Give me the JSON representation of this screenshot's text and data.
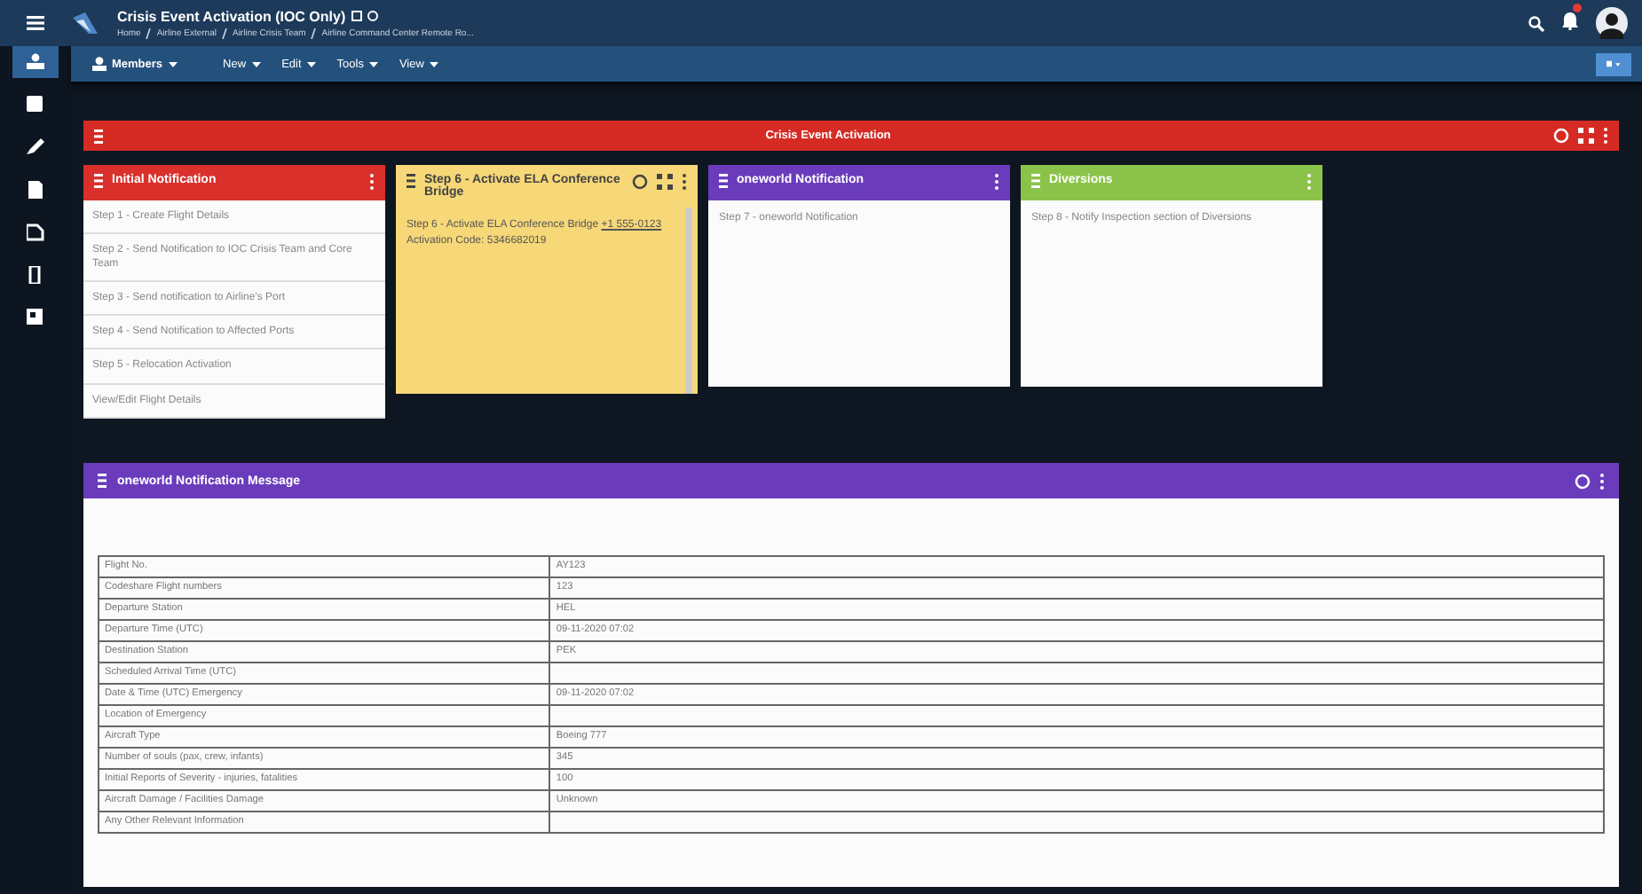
{
  "header": {
    "title": "Crisis Event Activation (IOC Only)",
    "breadcrumbs": [
      "Home",
      "Airline External",
      "Airline Crisis Team",
      "Airline Command Center Remote Ro..."
    ],
    "notifications": {
      "unread": true
    }
  },
  "toolbar": {
    "members": "Members",
    "menus": [
      "New",
      "Edit",
      "Tools",
      "View"
    ]
  },
  "sidebar": {
    "items": [
      {
        "selected": true
      },
      {
        "selected": false
      },
      {
        "selected": false
      },
      {
        "selected": false
      },
      {
        "selected": false
      },
      {
        "selected": false
      },
      {
        "selected": false
      }
    ]
  },
  "banner": {
    "title": "Crisis Event Activation",
    "tools": {
      "refresh": true,
      "expand": true,
      "more": true
    }
  },
  "cards": [
    {
      "title": "Initial Notification",
      "color": "#d9302c",
      "kind": "list",
      "tools": {
        "refresh": false,
        "expand": false,
        "more": true
      },
      "items": [
        "Step 1 - Create Flight Details",
        "Step 2 - Send Notification to IOC Crisis Team and Core Team",
        "Step 3 - Send notification to Airline's Port",
        "Step 4 - Send Notification to Affected Ports",
        "Step 5 - Relocation Activation",
        "View/Edit Flight Details"
      ]
    },
    {
      "title": "Step 6 - Activate ELA Conference Bridge",
      "color": "#f7d878",
      "kind": "text",
      "tools": {
        "refresh": true,
        "expand": true,
        "more": true
      },
      "body": [
        {
          "kind": "text",
          "text": "Step 6 - Activate ELA Conference Bridge "
        },
        {
          "kind": "link",
          "text": "+1 555-0123"
        },
        {
          "kind": "text",
          "text": " Activation Code: 5346682019"
        }
      ]
    },
    {
      "title": "oneworld Notification",
      "color": "#6a3cbc",
      "kind": "text",
      "tools": {
        "refresh": false,
        "expand": false,
        "more": true
      },
      "body": [
        {
          "kind": "text",
          "text": "Step 7 - oneworld Notification"
        }
      ]
    },
    {
      "title": "Diversions",
      "color": "#8bc34a",
      "kind": "text",
      "tools": {
        "refresh": false,
        "expand": false,
        "more": true
      },
      "body": [
        {
          "kind": "text",
          "text": "Step 8 - Notify Inspection section of Diversions"
        }
      ]
    }
  ],
  "message_panel": {
    "title": "oneworld Notification Message",
    "color": "#6a3cbc",
    "tools": {
      "refresh": true,
      "expand": false,
      "more": true
    },
    "rows": [
      {
        "label": "Flight No.",
        "value": "AY123"
      },
      {
        "label": "Codeshare Flight numbers",
        "value": "123"
      },
      {
        "label": "Departure Station",
        "value": "HEL"
      },
      {
        "label": "Departure Time (UTC)",
        "value": "09-11-2020 07:02"
      },
      {
        "label": "Destination Station",
        "value": "PEK"
      },
      {
        "label": "Scheduled Arrival Time (UTC)"
      },
      {
        "label": "Date & Time (UTC) Emergency",
        "value": "09-11-2020 07:02"
      },
      {
        "label": "Location of Emergency"
      },
      {
        "label": "Aircraft Type",
        "value": "Boeing 777"
      },
      {
        "label": "Number of souls (pax, crew, infants)",
        "value": "345"
      },
      {
        "label": "Initial Reports of Severity - injuries, fatalities",
        "value": "100"
      },
      {
        "label": "Aircraft Damage / Facilities Damage",
        "value": "Unknown"
      },
      {
        "label": "Any Other Relevant Information"
      }
    ]
  }
}
